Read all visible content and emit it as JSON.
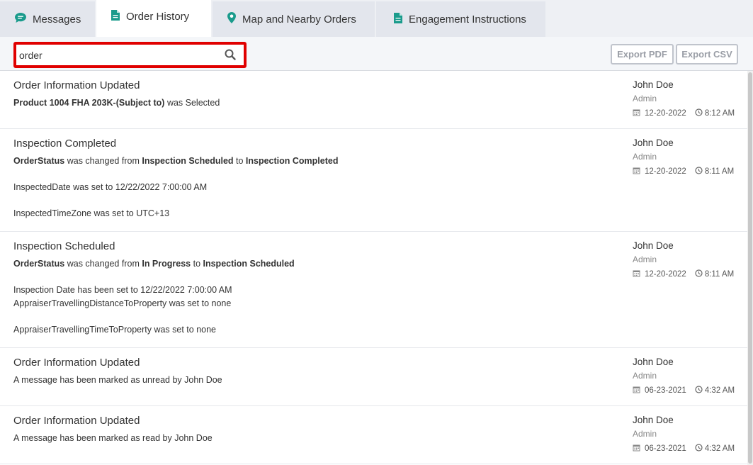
{
  "tabs": [
    {
      "label": "Messages",
      "icon": "chat-icon"
    },
    {
      "label": "Order History",
      "icon": "document-icon"
    },
    {
      "label": "Map and Nearby Orders",
      "icon": "map-pin-icon"
    },
    {
      "label": "Engagement Instructions",
      "icon": "document-icon"
    }
  ],
  "active_tab": "Order History",
  "search": {
    "value": "order"
  },
  "buttons": {
    "export_pdf": "Export PDF",
    "export_csv": "Export CSV"
  },
  "colors": {
    "accent": "#1a9b8c",
    "highlight": "#e00000"
  },
  "entries": [
    {
      "title": "Order Information Updated",
      "lines": [
        {
          "parts": [
            {
              "b": "Product 1004 FHA 203K-(Subject to)"
            },
            {
              "t": " was Selected"
            }
          ]
        }
      ],
      "user": "John Doe",
      "role": "Admin",
      "date": "12-20-2022",
      "time": "8:12 AM"
    },
    {
      "title": "Inspection Completed",
      "lines": [
        {
          "parts": [
            {
              "b": "OrderStatus"
            },
            {
              "t": " was changed from "
            },
            {
              "b": "Inspection Scheduled"
            },
            {
              "t": " to "
            },
            {
              "b": "Inspection Completed"
            }
          ]
        },
        {
          "parts": [
            {
              "t": "InspectedDate was set to 12/22/2022 7:00:00 AM"
            }
          ]
        },
        {
          "parts": [
            {
              "t": "InspectedTimeZone was set to UTC+13"
            }
          ]
        }
      ],
      "user": "John Doe",
      "role": "Admin",
      "date": "12-20-2022",
      "time": "8:11 AM"
    },
    {
      "title": "Inspection Scheduled",
      "lines": [
        {
          "parts": [
            {
              "b": "OrderStatus"
            },
            {
              "t": " was changed from "
            },
            {
              "b": "In Progress"
            },
            {
              "t": " to "
            },
            {
              "b": "Inspection Scheduled"
            }
          ]
        },
        {
          "parts": [
            {
              "t": "Inspection Date has been set to 12/22/2022 7:00:00 AM"
            }
          ]
        },
        {
          "parts": [
            {
              "t": "AppraiserTravellingDistanceToProperty was set to none"
            }
          ]
        },
        {
          "parts": [
            {
              "t": "AppraiserTravellingTimeToProperty was set to none"
            }
          ]
        }
      ],
      "user": "John Doe",
      "role": "Admin",
      "date": "12-20-2022",
      "time": "8:11 AM"
    },
    {
      "title": "Order Information Updated",
      "lines": [
        {
          "parts": [
            {
              "t": "A message has been marked as unread by John Doe"
            }
          ]
        }
      ],
      "user": "John Doe",
      "role": "Admin",
      "date": "06-23-2021",
      "time": "4:32 AM"
    },
    {
      "title": "Order Information Updated",
      "lines": [
        {
          "parts": [
            {
              "t": "A message has been marked as read by John Doe"
            }
          ]
        }
      ],
      "user": "John Doe",
      "role": "Admin",
      "date": "06-23-2021",
      "time": "4:32 AM"
    }
  ]
}
